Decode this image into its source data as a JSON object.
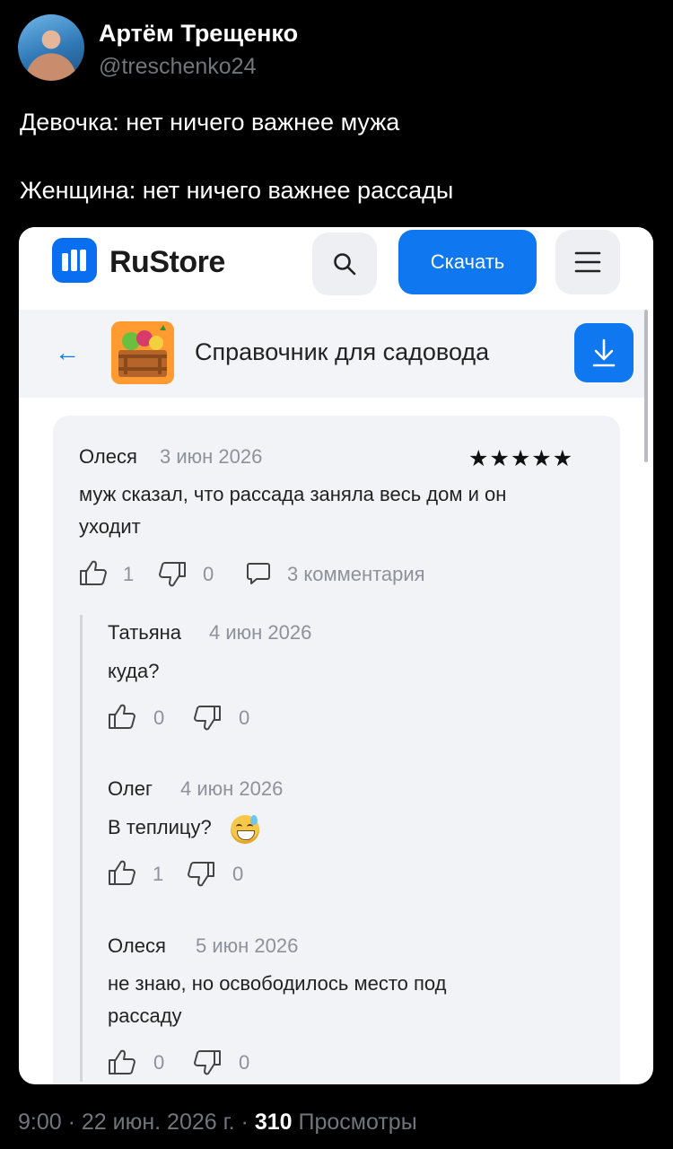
{
  "tweet": {
    "author_name": "Артём Трещенко",
    "author_handle": "@treschenko24",
    "line1": "Девочка: нет ничего важнее мужа",
    "line2": "Женщина: нет ничего важнее рассады",
    "time": "9:00 · 22 июн. 2026 г. ·",
    "views_count": "310",
    "views_label": "Просмотры"
  },
  "rustore": {
    "logo_text": "RuStore",
    "download_label": "Скачать",
    "app_title": "Справочник для садовода",
    "accent_color": "#0f77f0"
  },
  "review": {
    "author": "Олеся",
    "date": "3 июн 2026",
    "stars": "★★★★★",
    "text_line1": "муж сказал, что рассада заняла весь дом и он",
    "text_line2": "уходит",
    "likes": "1",
    "dislikes": "0",
    "comments_label": "3 комментария"
  },
  "replies": [
    {
      "author": "Татьяна",
      "date": "4 июн 2026",
      "text": "куда?",
      "likes": "0",
      "dislikes": "0"
    },
    {
      "author": "Олег",
      "date": "4 июн 2026",
      "text": "В теплицу?",
      "likes": "1",
      "dislikes": "0"
    },
    {
      "author": "Олеся",
      "date": "5 июн 2026",
      "text_line1": "не знаю, но освободилось место под",
      "text_line2": "рассаду",
      "likes": "0",
      "dislikes": "0"
    }
  ]
}
